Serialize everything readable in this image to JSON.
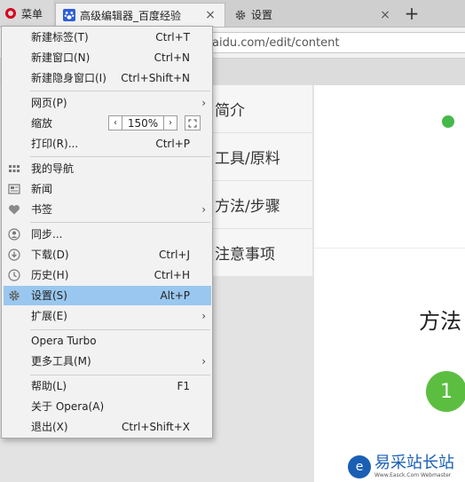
{
  "tabbar": {
    "menu_label": "菜单",
    "tabs": [
      {
        "title": "高级编辑器_百度经验",
        "close": "×"
      },
      {
        "title": "设置",
        "close": "×"
      }
    ],
    "new_tab": "+"
  },
  "address": {
    "url": "aidu.com/edit/content"
  },
  "page": {
    "nav": [
      "简介",
      "工具/原料",
      "方法/步骤",
      "注意事项"
    ],
    "method_title": "方法",
    "step_number": "1",
    "watermark_title": "易采站长站",
    "watermark_sub": "Www.Easck.Com  Webmaster"
  },
  "menu": {
    "items": [
      {
        "label": "新建标签(T)",
        "shortcut": "Ctrl+T"
      },
      {
        "label": "新建窗口(N)",
        "shortcut": "Ctrl+N"
      },
      {
        "label": "新建隐身窗口(I)",
        "shortcut": "Ctrl+Shift+N"
      },
      {
        "label": "网页(P)",
        "arrow": "›"
      },
      {
        "label": "缩放",
        "zoom": "150%",
        "zoom_dec": "‹",
        "zoom_inc": "›"
      },
      {
        "label": "打印(R)...",
        "shortcut": "Ctrl+P"
      },
      {
        "label": "我的导航",
        "icon": "grid-icon"
      },
      {
        "label": "新闻",
        "icon": "news-icon"
      },
      {
        "label": "书签",
        "icon": "heart-icon",
        "arrow": "›"
      },
      {
        "label": "同步...",
        "icon": "user-icon"
      },
      {
        "label": "下载(D)",
        "icon": "download-icon",
        "shortcut": "Ctrl+J"
      },
      {
        "label": "历史(H)",
        "icon": "clock-icon",
        "shortcut": "Ctrl+H"
      },
      {
        "label": "设置(S)",
        "icon": "gear-icon",
        "shortcut": "Alt+P",
        "highlighted": true
      },
      {
        "label": "扩展(E)",
        "arrow": "›"
      },
      {
        "label": "Opera Turbo"
      },
      {
        "label": "更多工具(M)",
        "arrow": "›"
      },
      {
        "label": "帮助(L)",
        "shortcut": "F1"
      },
      {
        "label": "关于 Opera(A)"
      },
      {
        "label": "退出(X)",
        "shortcut": "Ctrl+Shift+X"
      }
    ]
  },
  "colors": {
    "highlight": "#99c7ef",
    "opera_red": "#d6001c",
    "green": "#5cbe41"
  }
}
